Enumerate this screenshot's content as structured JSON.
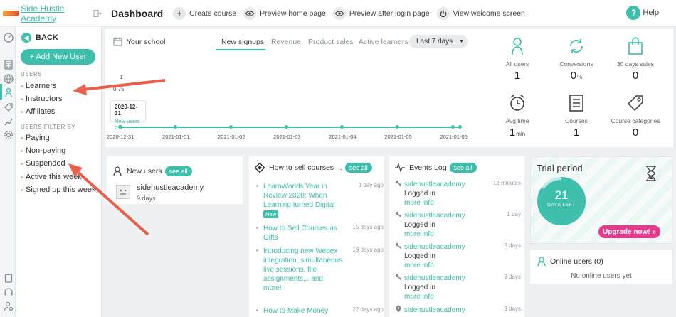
{
  "brand": {
    "school_name": "Side Hustle Academy"
  },
  "sidebar": {
    "back_label": "BACK",
    "add_user_label": "+ Add New User",
    "users_section": "USERS",
    "users": [
      "Learners",
      "Instructors",
      "Affiliates"
    ],
    "filter_section": "USERS FILTER BY",
    "filters": [
      "Paying",
      "Non-paying",
      "Suspended",
      "Active this week",
      "Signed up this week"
    ]
  },
  "header": {
    "title": "Dashboard",
    "actions": [
      "Create course",
      "Preview home page",
      "Preview after login page",
      "View welcome screen"
    ],
    "help_label": "Help"
  },
  "stats": {
    "school_label": "Your school",
    "tabs": [
      "New signups",
      "Revenue",
      "Product sales",
      "Active learners"
    ],
    "range": "Last 7 days",
    "tooltip": {
      "date": "2020-12-31",
      "text": "New users 0"
    },
    "cards": [
      {
        "label": "All users",
        "value": "1",
        "unit": ""
      },
      {
        "label": "Conversions",
        "value": "0",
        "unit": "%"
      },
      {
        "label": "30 days sales",
        "value": "0",
        "unit": ""
      },
      {
        "label": "Avg time",
        "value": "1",
        "unit": "min"
      },
      {
        "label": "Courses",
        "value": "1",
        "unit": ""
      },
      {
        "label": "Course categories",
        "value": "0",
        "unit": ""
      }
    ]
  },
  "chart_data": {
    "type": "line",
    "x": [
      "2020-12-31",
      "2021-01-01",
      "2021-01-02",
      "2021-01-03",
      "2021-01-04",
      "2021-01-05",
      "2021-01-06"
    ],
    "series": [
      {
        "values": [
          0,
          0,
          0,
          0,
          0,
          0,
          0
        ]
      }
    ],
    "ytick_labels": [
      "1",
      "0.75",
      "0"
    ],
    "ylim": [
      0,
      1
    ]
  },
  "new_users": {
    "title": "New users",
    "see_all": "see all",
    "items": [
      {
        "name": "sidehustleacademy",
        "time": "9 days"
      }
    ]
  },
  "sell_courses": {
    "title": "How to sell courses ...",
    "see_all": "see all",
    "new_badge": "New",
    "posts": [
      {
        "title": "LearnWorlds Year in Review 2020: When Learning turned Digital",
        "age": "1 day ago"
      },
      {
        "title": "How to Sell Courses as Gifts",
        "age": "15 days ago"
      },
      {
        "title": "Introducing new Webex integration, simultaneous live sessions, file assignments,.. and more!",
        "age": "19 days ago"
      },
      {
        "title": "How to Make Money",
        "age": "22 days ago"
      }
    ]
  },
  "events": {
    "title": "Events Log",
    "see_all": "see all",
    "items": [
      {
        "user": "sidehustleacademy",
        "text": "Logged in",
        "more": "more info",
        "age": "12 minutes"
      },
      {
        "user": "sidehustleacademy",
        "text": "Logged in",
        "more": "more info",
        "age": "1 day"
      },
      {
        "user": "sidehustleacademy",
        "text": "Logged in",
        "more": "more info",
        "age": "8 days"
      },
      {
        "user": "sidehustleacademy",
        "text": "Logged in",
        "more": "more info",
        "age": "9 days"
      },
      {
        "user": "sidehustleacademy",
        "age": "9 days"
      }
    ]
  },
  "trial": {
    "title": "Trial period",
    "days": "21",
    "days_label": "DAYS LEFT",
    "upgrade_label": "Upgrade now! »"
  },
  "online": {
    "title": "Online users (0)",
    "message": "No online users yet"
  },
  "colors": {
    "accent": "#3dbfab",
    "upgrade": "#e83a8c",
    "arrow": "#e8604c"
  }
}
